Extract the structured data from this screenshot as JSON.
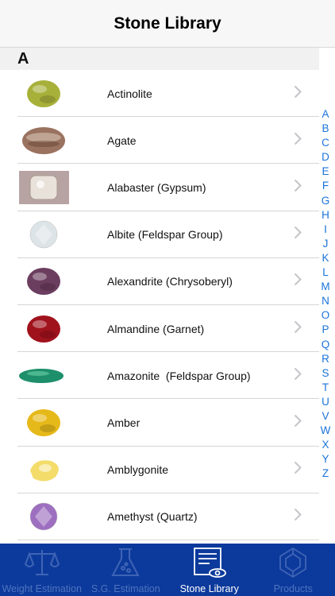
{
  "nav": {
    "title": "Stone Library"
  },
  "section": {
    "letter": "A"
  },
  "stones": [
    {
      "name": "Actinolite",
      "color": "#a7b13a"
    },
    {
      "name": "Agate",
      "color": "#9a7260"
    },
    {
      "name": "Alabaster (Gypsum)",
      "color": "#e9e2da"
    },
    {
      "name": "Albite (Feldspar Group)",
      "color": "#dde4e8"
    },
    {
      "name": "Alexandrite (Chrysoberyl)",
      "color": "#6b3d5e"
    },
    {
      "name": "Almandine (Garnet)",
      "color": "#a0121c"
    },
    {
      "name": "Amazonite  (Feldspar Group)",
      "color": "#1d8f6a"
    },
    {
      "name": "Amber",
      "color": "#e6b91a"
    },
    {
      "name": "Amblygonite",
      "color": "#f3dc6a"
    },
    {
      "name": "Amethyst (Quartz)",
      "color": "#9d6fc0"
    }
  ],
  "index_letters": [
    "A",
    "B",
    "C",
    "D",
    "E",
    "F",
    "G",
    "H",
    "I",
    "J",
    "K",
    "L",
    "M",
    "N",
    "O",
    "P",
    "Q",
    "R",
    "S",
    "T",
    "U",
    "V",
    "W",
    "X",
    "Y",
    "Z"
  ],
  "tabs": [
    {
      "label": "Weight Estimation",
      "icon": "scale-icon",
      "active": false
    },
    {
      "label": "S.G. Estimation",
      "icon": "flask-icon",
      "active": false
    },
    {
      "label": "Stone Library",
      "icon": "library-icon",
      "active": true
    },
    {
      "label": "Products",
      "icon": "gem-icon",
      "active": false
    }
  ],
  "colors": {
    "tabbar": "#0c3a9c",
    "index": "#1a73d9",
    "inactive_tab": "#4f73bf"
  }
}
